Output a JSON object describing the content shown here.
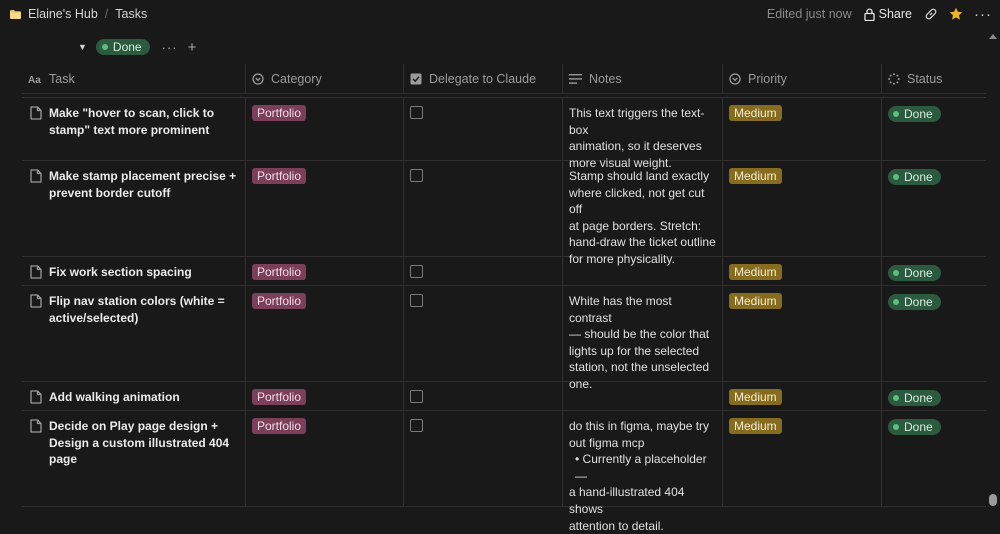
{
  "breadcrumb": {
    "workspace": "Elaine's Hub",
    "page": "Tasks"
  },
  "topbar": {
    "edited": "Edited just now",
    "share_label": "Share",
    "more": "···"
  },
  "group": {
    "label": "Done",
    "more": "···",
    "add": "+"
  },
  "columns": [
    {
      "label": "Task",
      "icon": "text-aa-icon"
    },
    {
      "label": "Category",
      "icon": "select-circle-icon"
    },
    {
      "label": "Delegate to Claude",
      "icon": "checkbox-icon"
    },
    {
      "label": "Notes",
      "icon": "lines-icon"
    },
    {
      "label": "Priority",
      "icon": "select-circle-icon"
    },
    {
      "label": "Status",
      "icon": "status-spinner-icon"
    }
  ],
  "rows": [
    {
      "task": "Make \"hover to scan, click to stamp\" text more prominent",
      "category": "Portfolio",
      "notes": [
        "This text triggers the text-box",
        "animation, so it deserves",
        "more visual weight."
      ],
      "priority": "Medium",
      "status": "Done"
    },
    {
      "task": "Make stamp placement precise + prevent border cutoff",
      "category": "Portfolio",
      "notes": [
        "Stamp should land exactly",
        "where clicked, not get cut off",
        "at page borders. Stretch:",
        "hand-draw the ticket outline",
        "for more physicality."
      ],
      "priority": "Medium",
      "status": "Done"
    },
    {
      "task": "Fix work section spacing",
      "category": "Portfolio",
      "notes": [],
      "priority": "Medium",
      "status": "Done"
    },
    {
      "task": "Flip nav station colors (white = active/selected)",
      "category": "Portfolio",
      "notes": [
        "White has the most contrast",
        "— should be the color that",
        "lights up for the selected",
        "station, not the unselected",
        "one."
      ],
      "priority": "Medium",
      "status": "Done"
    },
    {
      "task": "Add walking animation",
      "category": "Portfolio",
      "notes": [],
      "priority": "Medium",
      "status": "Done"
    },
    {
      "task": "Decide on Play page design + Design a custom illustrated 404 page",
      "category": "Portfolio",
      "notes": [
        "do this in figma, maybe try",
        "out figma mcp",
        "• Currently a placeholder —",
        "a hand-illustrated 404 shows",
        "attention to detail."
      ],
      "priority": "Medium",
      "status": "Done"
    }
  ]
}
